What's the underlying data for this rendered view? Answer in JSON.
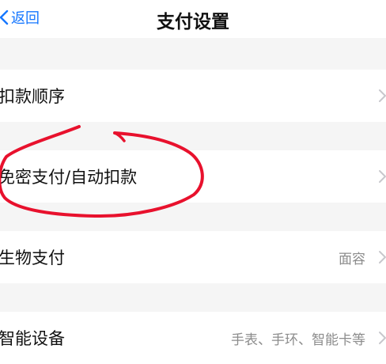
{
  "header": {
    "back_label": "返回",
    "title": "支付设置"
  },
  "rows": [
    {
      "label": "扣款顺序",
      "value": ""
    },
    {
      "label": "免密支付/自动扣款",
      "value": ""
    },
    {
      "label": "生物支付",
      "value": "面容"
    },
    {
      "label": "智能设备",
      "value": "手表、手环、智能卡等"
    }
  ],
  "colors": {
    "accent": "#1677ff",
    "annotation": "#e8112d",
    "background": "#f5f5f5",
    "chevron": "#c7c7cc"
  },
  "icons": {
    "back": "chevron-left-icon",
    "row_arrow": "chevron-right-icon"
  },
  "annotation": "hand-drawn-circle"
}
